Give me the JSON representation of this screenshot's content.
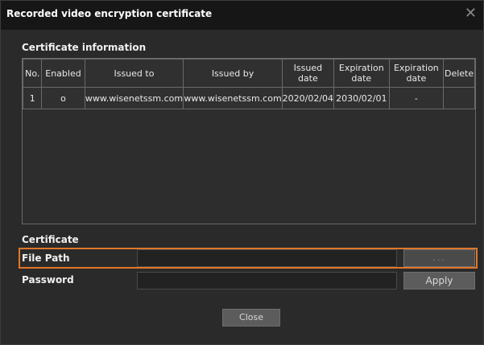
{
  "dialog": {
    "title": "Recorded video encryption certificate",
    "close_glyph": "✕"
  },
  "certificate_information": {
    "section_label": "Certificate information",
    "columns": [
      "No.",
      "Enabled",
      "Issued to",
      "Issued by",
      "Issued date",
      "Expiration date",
      "Expiration date",
      "Delete"
    ],
    "rows": [
      [
        "1",
        "o",
        "www.wisenetssm.com",
        "www.wisenetssm.com",
        "2020/02/04",
        "2030/02/01",
        "-",
        ""
      ]
    ]
  },
  "certificate": {
    "section_label": "Certificate",
    "file_path_label": "File Path",
    "file_path_value": "",
    "browse_label": "...",
    "password_label": "Password",
    "password_value": "",
    "apply_label": "Apply"
  },
  "footer": {
    "close_label": "Close"
  },
  "colors": {
    "highlight": "#e2762a"
  }
}
